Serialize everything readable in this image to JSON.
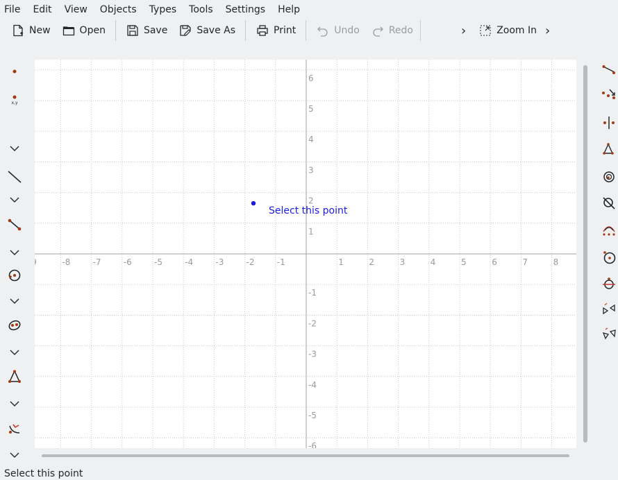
{
  "menu": [
    "File",
    "Edit",
    "View",
    "Objects",
    "Types",
    "Tools",
    "Settings",
    "Help"
  ],
  "toolbar": {
    "new_label": "New",
    "open_label": "Open",
    "save_label": "Save",
    "saveas_label": "Save As",
    "print_label": "Print",
    "undo_label": "Undo",
    "redo_label": "Redo",
    "zoomin_label": "Zoom In",
    "more_glyph": "›"
  },
  "canvas": {
    "x_ticks": [
      "9",
      "-8",
      "-7",
      "-6",
      "-5",
      "-4",
      "-3",
      "-2",
      "-1",
      "1",
      "2",
      "3",
      "4",
      "5",
      "6",
      "7",
      "8"
    ],
    "y_ticks": [
      "6",
      "5",
      "4",
      "3",
      "2",
      "1",
      "-1",
      "-2",
      "-3",
      "-4",
      "-5",
      "-6"
    ],
    "hint_text": "Select this point",
    "point_color": "#1c1ce0"
  },
  "status": {
    "text": "Select this point"
  },
  "left_palette": [
    "point-icon",
    "point-by-coordinates-icon",
    "chevron-down-icon",
    "line-icon",
    "chevron-down-icon",
    "segment-icon",
    "chevron-down-icon",
    "circle-icon",
    "chevron-down-icon",
    "conic-icon",
    "chevron-down-icon",
    "polygon-icon",
    "chevron-down-icon",
    "transformation-icon",
    "chevron-down-icon"
  ],
  "right_palette": [
    "ray-icon",
    "vector-icon",
    "mirror-point-icon",
    "triangle-icon",
    "arc-icon",
    "intersection-icon",
    "arc-three-points-icon",
    "circle-by-center-icon",
    "tangent-icon",
    "translate-icon",
    "reflect-icon"
  ]
}
